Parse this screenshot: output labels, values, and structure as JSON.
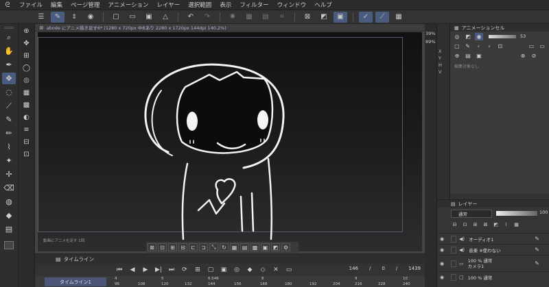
{
  "menubar": {
    "items": [
      "ファイル",
      "編集",
      "ページ管理",
      "アニメーション",
      "レイヤー",
      "選択範囲",
      "表示",
      "フィルター",
      "ウィンドウ",
      "ヘルプ"
    ]
  },
  "document": {
    "tab_title": "abode にアニメ描き足す6* (1280 x 720px 中Bあり 2280 x 1720px 144dpi 140.2%)",
    "caption": "動画にアニメを足す 1回"
  },
  "timeline": {
    "title": "タイムライン",
    "track_name": "タイムライン1",
    "current_frame": "146",
    "playback_value": "0",
    "total_frames": "1439",
    "ruler_top": [
      "1",
      "4",
      "5",
      "6",
      "6.546",
      "7",
      "8",
      "9",
      "10"
    ],
    "ruler_bottom": [
      "96",
      "108",
      "120",
      "132",
      "144",
      "156",
      "168",
      "180",
      "192",
      "204",
      "216",
      "228",
      "240"
    ]
  },
  "right": {
    "zoom_values": [
      "39%",
      "89%"
    ],
    "mini_labels": [
      "X",
      "Y",
      "H",
      "V"
    ],
    "animation_panel": {
      "title": "アニメーションセル",
      "opacity": "53",
      "empty_hint": "編集対象なし"
    },
    "layer_panel": {
      "title": "レイヤー",
      "blend_mode": "通常",
      "opacity": "100",
      "layers": [
        {
          "name": "オーディオ1",
          "selected": false
        },
        {
          "name": "音楽 ※使わない",
          "selected": false
        },
        {
          "name": "100 % 通常\nカメラ1",
          "selected": false
        },
        {
          "name": "100 % 通常",
          "selected": false
        }
      ]
    }
  }
}
